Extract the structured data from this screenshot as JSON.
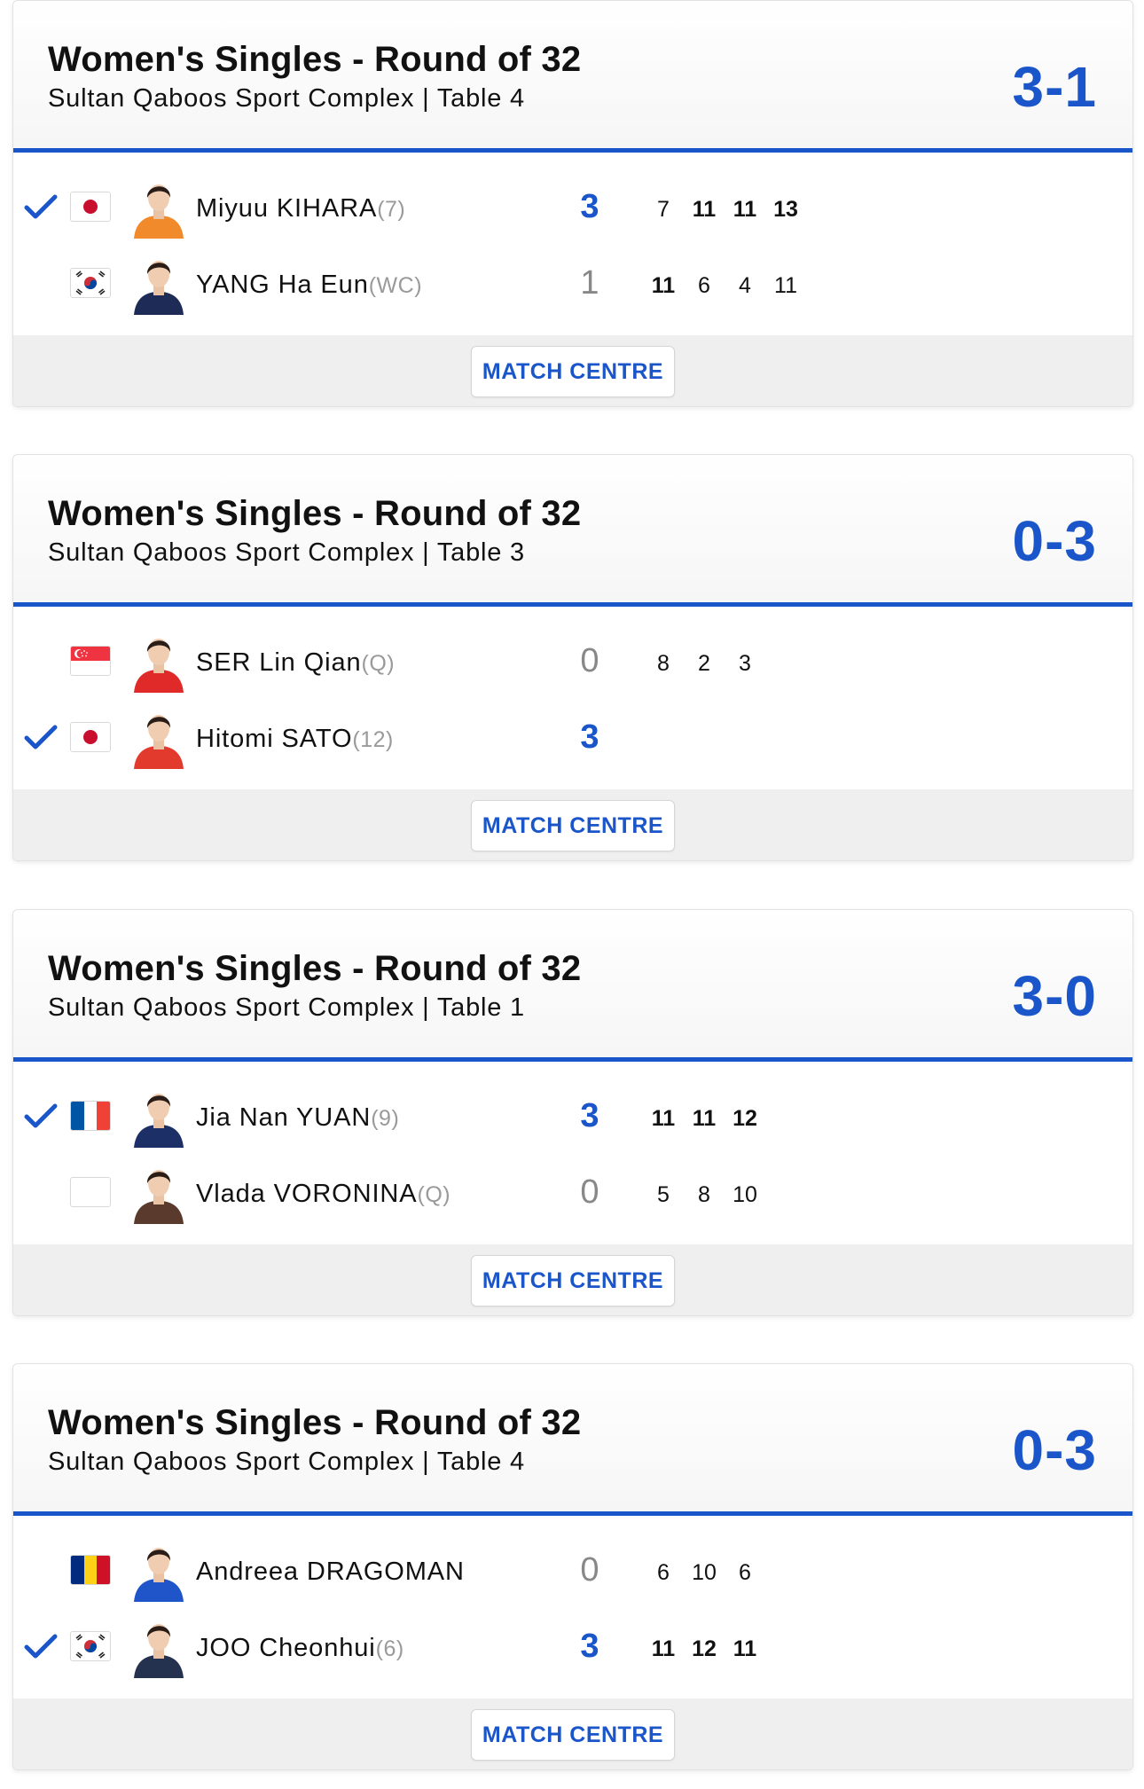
{
  "colors": {
    "accent": "#1a56c9",
    "seed": "#9a9a9a",
    "footer": "#efefef"
  },
  "matches": [
    {
      "title": "Women's Singles - Round of 32",
      "venue": "Sultan Qaboos Sport Complex | Table 4",
      "score": "3-1",
      "button": "MATCH CENTRE",
      "players": [
        {
          "name": "Miyuu KIHARA",
          "seed": "(7)",
          "country": "JPN",
          "flag_icon": "japan-flag-icon",
          "winner": true,
          "games": "3",
          "sets": [
            "7",
            "11",
            "11",
            "13"
          ],
          "sets_won": [
            false,
            true,
            true,
            true
          ]
        },
        {
          "name": "YANG Ha Eun",
          "seed": "(WC)",
          "country": "KOR",
          "flag_icon": "korea-flag-icon",
          "winner": false,
          "games": "1",
          "sets": [
            "11",
            "6",
            "4",
            "11"
          ],
          "sets_won": [
            true,
            false,
            false,
            false
          ]
        }
      ]
    },
    {
      "title": "Women's Singles - Round of 32",
      "venue": "Sultan Qaboos Sport Complex | Table 3",
      "score": "0-3",
      "button": "MATCH CENTRE",
      "players": [
        {
          "name": "SER Lin Qian",
          "seed": "(Q)",
          "country": "SGP",
          "flag_icon": "singapore-flag-icon",
          "winner": false,
          "games": "0",
          "sets": [
            "8",
            "2",
            "3"
          ],
          "sets_won": [
            false,
            false,
            false
          ]
        },
        {
          "name": "Hitomi SATO",
          "seed": "(12)",
          "country": "JPN",
          "flag_icon": "japan-flag-icon",
          "winner": true,
          "games": "3",
          "sets": [],
          "sets_won": []
        }
      ]
    },
    {
      "title": "Women's Singles - Round of 32",
      "venue": "Sultan Qaboos Sport Complex | Table 1",
      "score": "3-0",
      "button": "MATCH CENTRE",
      "players": [
        {
          "name": "Jia Nan YUAN",
          "seed": "(9)",
          "country": "FRA",
          "flag_icon": "france-flag-icon",
          "winner": true,
          "games": "3",
          "sets": [
            "11",
            "11",
            "12"
          ],
          "sets_won": [
            true,
            true,
            true
          ]
        },
        {
          "name": "Vlada VORONINA",
          "seed": "(Q)",
          "country": "",
          "flag_icon": "blank-flag-icon",
          "winner": false,
          "games": "0",
          "sets": [
            "5",
            "8",
            "10"
          ],
          "sets_won": [
            false,
            false,
            false
          ]
        }
      ]
    },
    {
      "title": "Women's Singles - Round of 32",
      "venue": "Sultan Qaboos Sport Complex | Table 4",
      "score": "0-3",
      "button": "MATCH CENTRE",
      "players": [
        {
          "name": "Andreea DRAGOMAN",
          "seed": "",
          "country": "ROU",
          "flag_icon": "romania-flag-icon",
          "winner": false,
          "games": "0",
          "sets": [
            "6",
            "10",
            "6"
          ],
          "sets_won": [
            false,
            false,
            false
          ]
        },
        {
          "name": "JOO Cheonhui",
          "seed": "(6)",
          "country": "KOR",
          "flag_icon": "korea-flag-icon",
          "winner": true,
          "games": "3",
          "sets": [
            "11",
            "12",
            "11"
          ],
          "sets_won": [
            true,
            true,
            true
          ]
        }
      ]
    }
  ]
}
